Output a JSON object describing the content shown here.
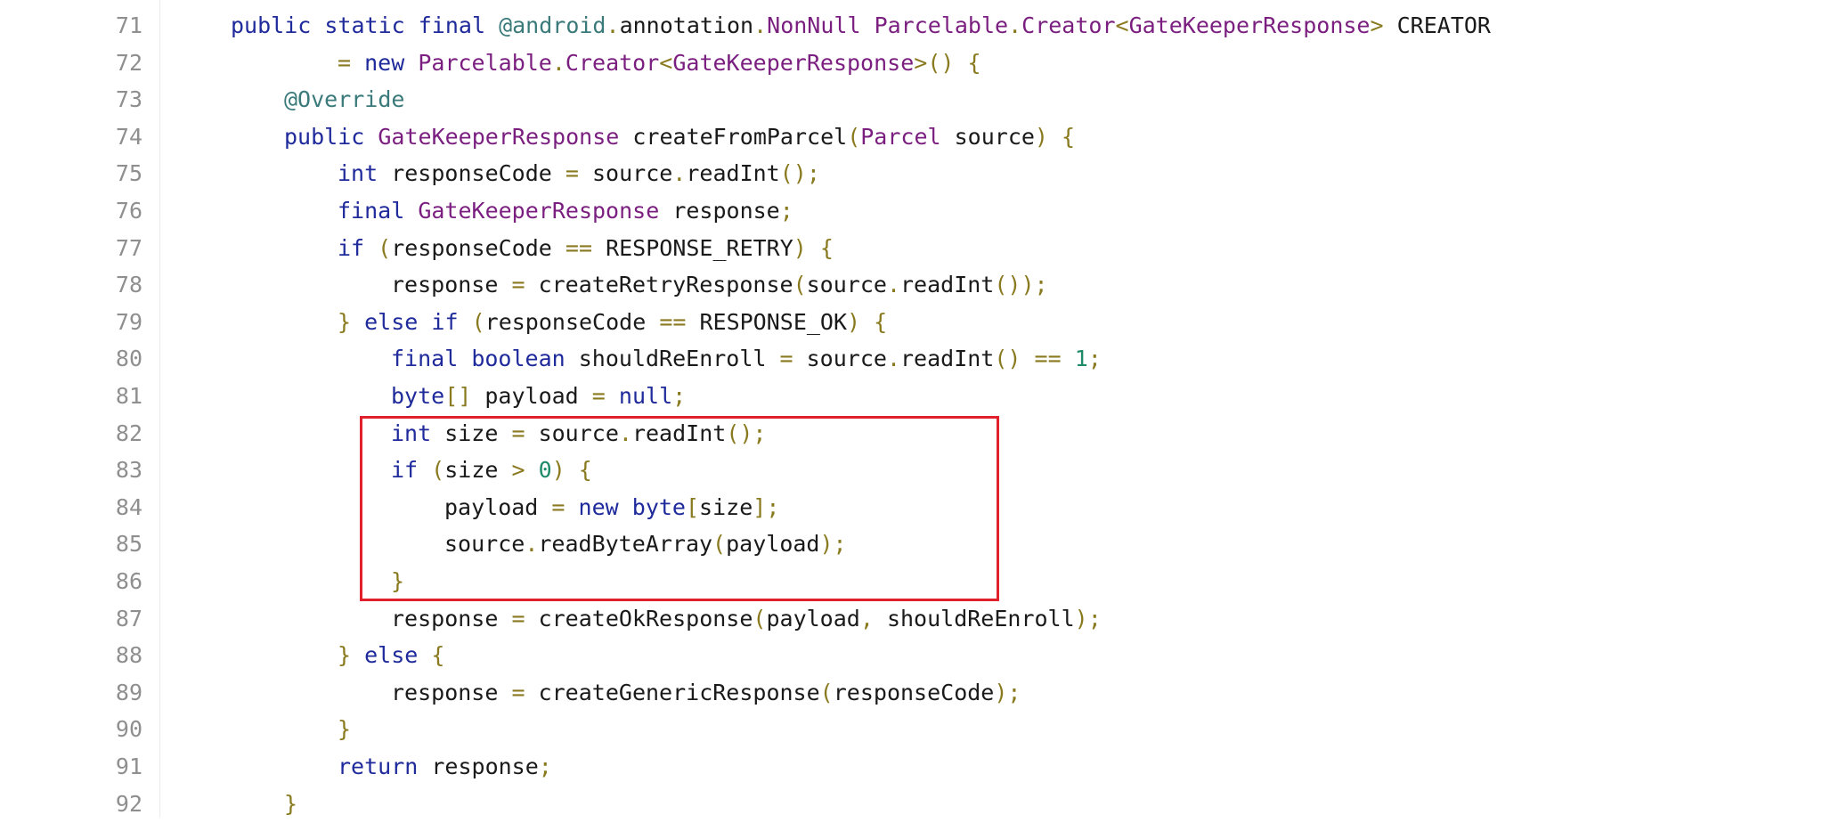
{
  "colors": {
    "keyword": "#1f2a9b",
    "type": "#7a1f7f",
    "annotation": "#3b7a7a",
    "punctuation": "#8a7a1f",
    "number": "#1f8a6a",
    "plain": "#1a1a1a",
    "line_number": "#8f8f8f",
    "highlight_border": "#e0202a"
  },
  "lines": [
    {
      "number": "71",
      "indent": 0,
      "tokens": [
        {
          "t": "public",
          "k": "keyword"
        },
        {
          "t": " ",
          "k": "plain"
        },
        {
          "t": "static",
          "k": "keyword"
        },
        {
          "t": " ",
          "k": "plain"
        },
        {
          "t": "final",
          "k": "keyword"
        },
        {
          "t": " ",
          "k": "plain"
        },
        {
          "t": "@android",
          "k": "annotation"
        },
        {
          "t": ".",
          "k": "punctuation"
        },
        {
          "t": "annotation",
          "k": "plain"
        },
        {
          "t": ".",
          "k": "punctuation"
        },
        {
          "t": "NonNull",
          "k": "type"
        },
        {
          "t": " ",
          "k": "plain"
        },
        {
          "t": "Parcelable",
          "k": "type"
        },
        {
          "t": ".",
          "k": "punctuation"
        },
        {
          "t": "Creator",
          "k": "type"
        },
        {
          "t": "<",
          "k": "punctuation"
        },
        {
          "t": "GateKeeperResponse",
          "k": "type"
        },
        {
          "t": ">",
          "k": "punctuation"
        },
        {
          "t": " CREATOR",
          "k": "plain"
        }
      ]
    },
    {
      "number": "72",
      "indent": 2,
      "tokens": [
        {
          "t": "=",
          "k": "punctuation"
        },
        {
          "t": " ",
          "k": "plain"
        },
        {
          "t": "new",
          "k": "keyword"
        },
        {
          "t": " ",
          "k": "plain"
        },
        {
          "t": "Parcelable",
          "k": "type"
        },
        {
          "t": ".",
          "k": "punctuation"
        },
        {
          "t": "Creator",
          "k": "type"
        },
        {
          "t": "<",
          "k": "punctuation"
        },
        {
          "t": "GateKeeperResponse",
          "k": "type"
        },
        {
          "t": ">() {",
          "k": "punctuation"
        }
      ]
    },
    {
      "number": "73",
      "indent": 1,
      "tokens": [
        {
          "t": "@Override",
          "k": "annotation"
        }
      ]
    },
    {
      "number": "74",
      "indent": 1,
      "tokens": [
        {
          "t": "public",
          "k": "keyword"
        },
        {
          "t": " ",
          "k": "plain"
        },
        {
          "t": "GateKeeperResponse",
          "k": "type"
        },
        {
          "t": " createFromParcel",
          "k": "plain"
        },
        {
          "t": "(",
          "k": "punctuation"
        },
        {
          "t": "Parcel",
          "k": "type"
        },
        {
          "t": " source",
          "k": "plain"
        },
        {
          "t": ") {",
          "k": "punctuation"
        }
      ]
    },
    {
      "number": "75",
      "indent": 2,
      "tokens": [
        {
          "t": "int",
          "k": "keyword"
        },
        {
          "t": " responseCode ",
          "k": "plain"
        },
        {
          "t": "=",
          "k": "punctuation"
        },
        {
          "t": " source",
          "k": "plain"
        },
        {
          "t": ".",
          "k": "punctuation"
        },
        {
          "t": "readInt",
          "k": "plain"
        },
        {
          "t": "();",
          "k": "punctuation"
        }
      ]
    },
    {
      "number": "76",
      "indent": 2,
      "tokens": [
        {
          "t": "final",
          "k": "keyword"
        },
        {
          "t": " ",
          "k": "plain"
        },
        {
          "t": "GateKeeperResponse",
          "k": "type"
        },
        {
          "t": " response",
          "k": "plain"
        },
        {
          "t": ";",
          "k": "punctuation"
        }
      ]
    },
    {
      "number": "77",
      "indent": 2,
      "tokens": [
        {
          "t": "if",
          "k": "keyword"
        },
        {
          "t": " ",
          "k": "plain"
        },
        {
          "t": "(",
          "k": "punctuation"
        },
        {
          "t": "responseCode ",
          "k": "plain"
        },
        {
          "t": "==",
          "k": "punctuation"
        },
        {
          "t": " RESPONSE_RETRY",
          "k": "plain"
        },
        {
          "t": ") {",
          "k": "punctuation"
        }
      ]
    },
    {
      "number": "78",
      "indent": 3,
      "tokens": [
        {
          "t": "response ",
          "k": "plain"
        },
        {
          "t": "=",
          "k": "punctuation"
        },
        {
          "t": " createRetryResponse",
          "k": "plain"
        },
        {
          "t": "(",
          "k": "punctuation"
        },
        {
          "t": "source",
          "k": "plain"
        },
        {
          "t": ".",
          "k": "punctuation"
        },
        {
          "t": "readInt",
          "k": "plain"
        },
        {
          "t": "());",
          "k": "punctuation"
        }
      ]
    },
    {
      "number": "79",
      "indent": 2,
      "tokens": [
        {
          "t": "}",
          "k": "punctuation"
        },
        {
          "t": " ",
          "k": "plain"
        },
        {
          "t": "else",
          "k": "keyword"
        },
        {
          "t": " ",
          "k": "plain"
        },
        {
          "t": "if",
          "k": "keyword"
        },
        {
          "t": " ",
          "k": "plain"
        },
        {
          "t": "(",
          "k": "punctuation"
        },
        {
          "t": "responseCode ",
          "k": "plain"
        },
        {
          "t": "==",
          "k": "punctuation"
        },
        {
          "t": " RESPONSE_OK",
          "k": "plain"
        },
        {
          "t": ") {",
          "k": "punctuation"
        }
      ]
    },
    {
      "number": "80",
      "indent": 3,
      "tokens": [
        {
          "t": "final",
          "k": "keyword"
        },
        {
          "t": " ",
          "k": "plain"
        },
        {
          "t": "boolean",
          "k": "keyword"
        },
        {
          "t": " shouldReEnroll ",
          "k": "plain"
        },
        {
          "t": "=",
          "k": "punctuation"
        },
        {
          "t": " source",
          "k": "plain"
        },
        {
          "t": ".",
          "k": "punctuation"
        },
        {
          "t": "readInt",
          "k": "plain"
        },
        {
          "t": "()",
          "k": "punctuation"
        },
        {
          "t": " ",
          "k": "plain"
        },
        {
          "t": "==",
          "k": "punctuation"
        },
        {
          "t": " ",
          "k": "plain"
        },
        {
          "t": "1",
          "k": "number"
        },
        {
          "t": ";",
          "k": "punctuation"
        }
      ]
    },
    {
      "number": "81",
      "indent": 3,
      "tokens": [
        {
          "t": "byte",
          "k": "keyword"
        },
        {
          "t": "[]",
          "k": "punctuation"
        },
        {
          "t": " payload ",
          "k": "plain"
        },
        {
          "t": "=",
          "k": "punctuation"
        },
        {
          "t": " ",
          "k": "plain"
        },
        {
          "t": "null",
          "k": "keyword"
        },
        {
          "t": ";",
          "k": "punctuation"
        }
      ]
    },
    {
      "number": "82",
      "indent": 3,
      "tokens": [
        {
          "t": "int",
          "k": "keyword"
        },
        {
          "t": " size ",
          "k": "plain"
        },
        {
          "t": "=",
          "k": "punctuation"
        },
        {
          "t": " source",
          "k": "plain"
        },
        {
          "t": ".",
          "k": "punctuation"
        },
        {
          "t": "readInt",
          "k": "plain"
        },
        {
          "t": "();",
          "k": "punctuation"
        }
      ]
    },
    {
      "number": "83",
      "indent": 3,
      "tokens": [
        {
          "t": "if",
          "k": "keyword"
        },
        {
          "t": " ",
          "k": "plain"
        },
        {
          "t": "(",
          "k": "punctuation"
        },
        {
          "t": "size ",
          "k": "plain"
        },
        {
          "t": ">",
          "k": "punctuation"
        },
        {
          "t": " ",
          "k": "plain"
        },
        {
          "t": "0",
          "k": "number"
        },
        {
          "t": ") {",
          "k": "punctuation"
        }
      ]
    },
    {
      "number": "84",
      "indent": 4,
      "tokens": [
        {
          "t": "payload ",
          "k": "plain"
        },
        {
          "t": "=",
          "k": "punctuation"
        },
        {
          "t": " ",
          "k": "plain"
        },
        {
          "t": "new",
          "k": "keyword"
        },
        {
          "t": " ",
          "k": "plain"
        },
        {
          "t": "byte",
          "k": "keyword"
        },
        {
          "t": "[",
          "k": "punctuation"
        },
        {
          "t": "size",
          "k": "plain"
        },
        {
          "t": "];",
          "k": "punctuation"
        }
      ]
    },
    {
      "number": "85",
      "indent": 4,
      "tokens": [
        {
          "t": "source",
          "k": "plain"
        },
        {
          "t": ".",
          "k": "punctuation"
        },
        {
          "t": "readByteArray",
          "k": "plain"
        },
        {
          "t": "(",
          "k": "punctuation"
        },
        {
          "t": "payload",
          "k": "plain"
        },
        {
          "t": ");",
          "k": "punctuation"
        }
      ]
    },
    {
      "number": "86",
      "indent": 3,
      "tokens": [
        {
          "t": "}",
          "k": "punctuation"
        }
      ]
    },
    {
      "number": "87",
      "indent": 3,
      "tokens": [
        {
          "t": "response ",
          "k": "plain"
        },
        {
          "t": "=",
          "k": "punctuation"
        },
        {
          "t": " createOkResponse",
          "k": "plain"
        },
        {
          "t": "(",
          "k": "punctuation"
        },
        {
          "t": "payload",
          "k": "plain"
        },
        {
          "t": ",",
          "k": "punctuation"
        },
        {
          "t": " shouldReEnroll",
          "k": "plain"
        },
        {
          "t": ");",
          "k": "punctuation"
        }
      ]
    },
    {
      "number": "88",
      "indent": 2,
      "tokens": [
        {
          "t": "}",
          "k": "punctuation"
        },
        {
          "t": " ",
          "k": "plain"
        },
        {
          "t": "else",
          "k": "keyword"
        },
        {
          "t": " {",
          "k": "punctuation"
        }
      ]
    },
    {
      "number": "89",
      "indent": 3,
      "tokens": [
        {
          "t": "response ",
          "k": "plain"
        },
        {
          "t": "=",
          "k": "punctuation"
        },
        {
          "t": " createGenericResponse",
          "k": "plain"
        },
        {
          "t": "(",
          "k": "punctuation"
        },
        {
          "t": "responseCode",
          "k": "plain"
        },
        {
          "t": ");",
          "k": "punctuation"
        }
      ]
    },
    {
      "number": "90",
      "indent": 2,
      "tokens": [
        {
          "t": "}",
          "k": "punctuation"
        }
      ]
    },
    {
      "number": "91",
      "indent": 2,
      "tokens": [
        {
          "t": "return",
          "k": "keyword"
        },
        {
          "t": " response",
          "k": "plain"
        },
        {
          "t": ";",
          "k": "punctuation"
        }
      ]
    },
    {
      "number": "92",
      "indent": 1,
      "tokens": [
        {
          "t": "}",
          "k": "punctuation"
        }
      ]
    }
  ]
}
